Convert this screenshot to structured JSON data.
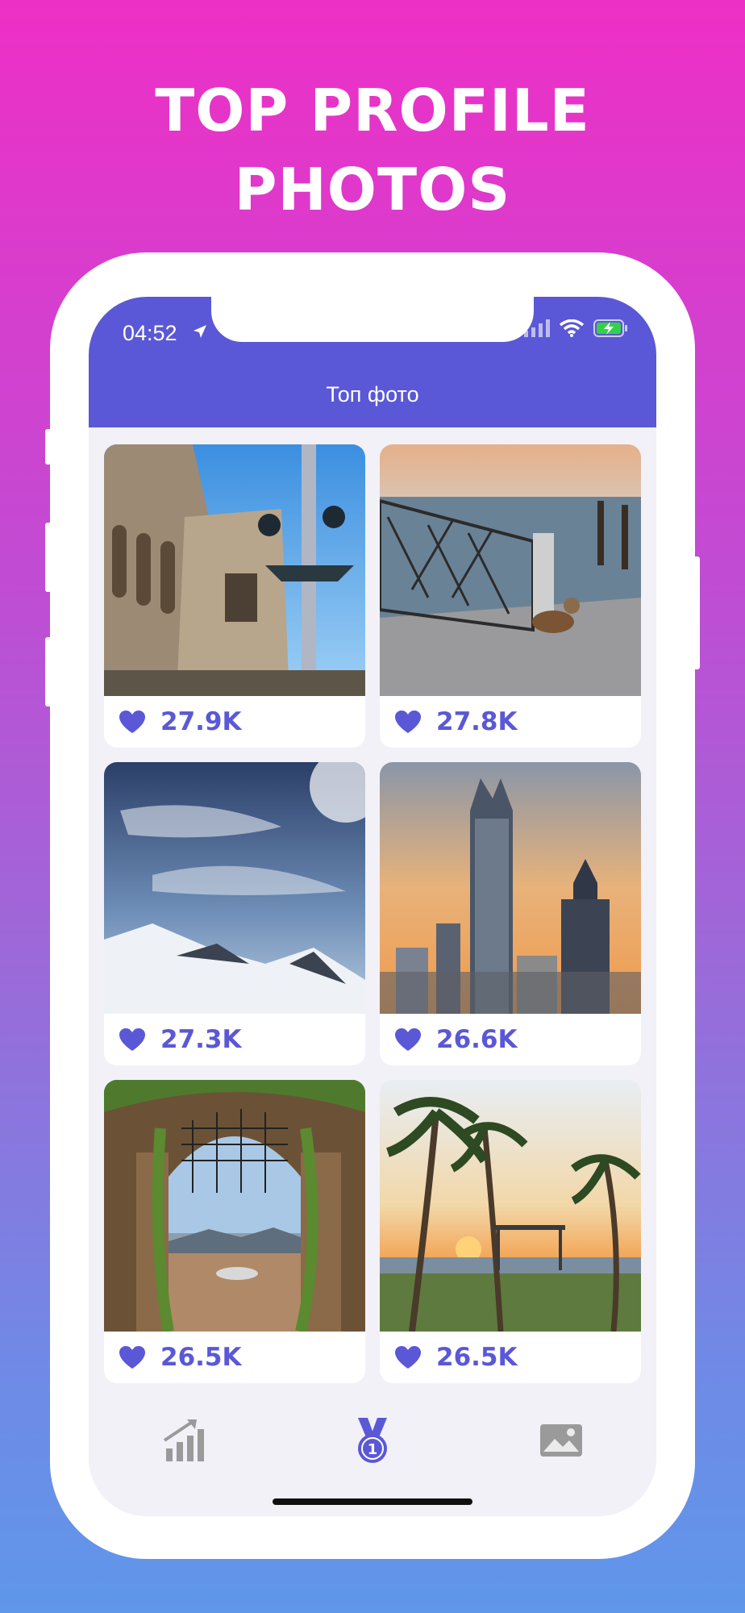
{
  "promo": {
    "headline_line1": "TOP PROFILE",
    "headline_line2": "PHOTOS"
  },
  "status_bar": {
    "time": "04:52",
    "icons": [
      "location-arrow-icon",
      "signal-icon",
      "wifi-icon",
      "battery-charging-icon"
    ]
  },
  "nav": {
    "title": "Топ фото"
  },
  "colors": {
    "accent": "#5a58d6",
    "background": "#f2f1f7",
    "tab_inactive": "#9a9a9a"
  },
  "photos": [
    {
      "likes": "27.9K",
      "subject": "ornate building with lamp post"
    },
    {
      "likes": "27.8K",
      "subject": "dog by waterfront railing"
    },
    {
      "likes": "27.3K",
      "subject": "snowy mountains under sky"
    },
    {
      "likes": "26.6K",
      "subject": "city skyscrapers at sunset"
    },
    {
      "likes": "26.5K",
      "subject": "garden gate with sea view"
    },
    {
      "likes": "26.5K",
      "subject": "palm trees on beach"
    }
  ],
  "tabs": [
    {
      "icon": "chart-trend-icon",
      "active": false
    },
    {
      "icon": "medal-icon",
      "active": true
    },
    {
      "icon": "photo-icon",
      "active": false
    }
  ]
}
